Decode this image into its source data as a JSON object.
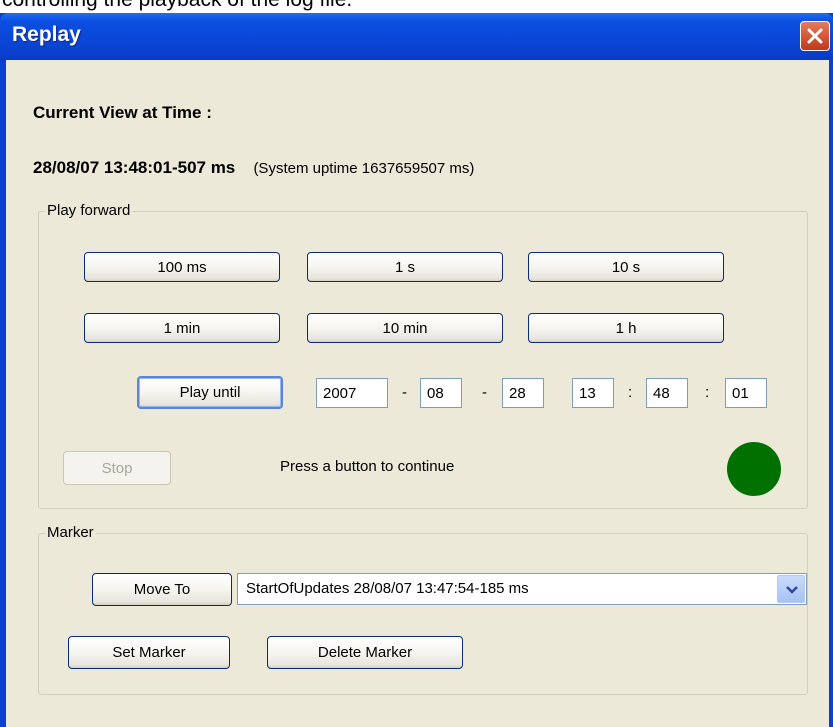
{
  "caption": "controlling the playback of the log file.",
  "window": {
    "title": "Replay"
  },
  "current_view_label": "Current View at Time :",
  "current_time": "28/08/07 13:48:01-507 ms",
  "system_uptime": "(System uptime 1637659507 ms)",
  "play_forward": {
    "legend": "Play forward",
    "step_buttons": [
      "100 ms",
      "1 s",
      "10 s",
      "1 min",
      "10 min",
      "1 h"
    ],
    "play_until_label": "Play until",
    "until": {
      "year": "2007",
      "month": "08",
      "day": "28",
      "hour": "13",
      "minute": "48",
      "second": "01"
    },
    "date_separator": "-",
    "time_separator": ":",
    "stop_label": "Stop",
    "status_text": "Press a button to continue",
    "indicator_color": "#007000"
  },
  "marker": {
    "legend": "Marker",
    "move_to_label": "Move To",
    "selected": "StartOfUpdates 28/08/07 13:47:54-185 ms",
    "set_marker_label": "Set Marker",
    "delete_marker_label": "Delete Marker"
  },
  "colors": {
    "title_bar": "#0a46d8",
    "client_bg": "#ece9d8",
    "close": "#c2381a"
  }
}
